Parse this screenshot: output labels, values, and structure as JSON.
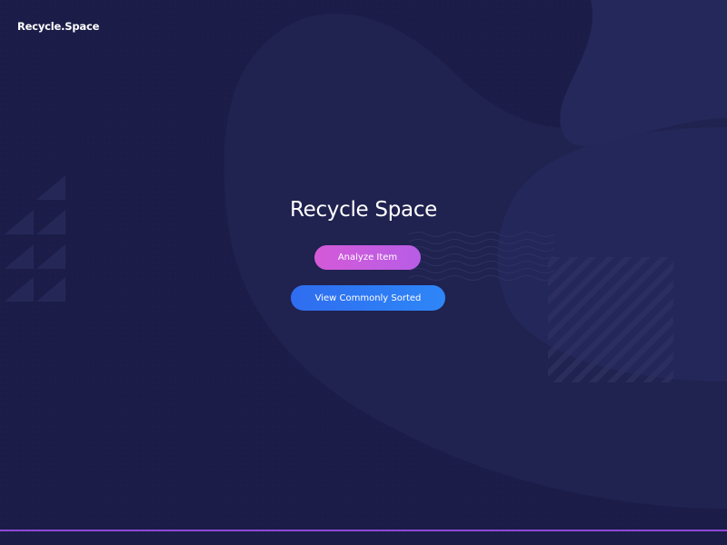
{
  "header": {
    "brand": "Recycle.Space"
  },
  "hero": {
    "title": "Recycle Space",
    "analyze_label": "Analyze Item",
    "view_label": "View Commonly Sorted"
  },
  "colors": {
    "background": "#1b1d48",
    "analyze_button": "#c95adf",
    "view_button": "#2f78f3",
    "bottom_line": "#8f48d8"
  }
}
